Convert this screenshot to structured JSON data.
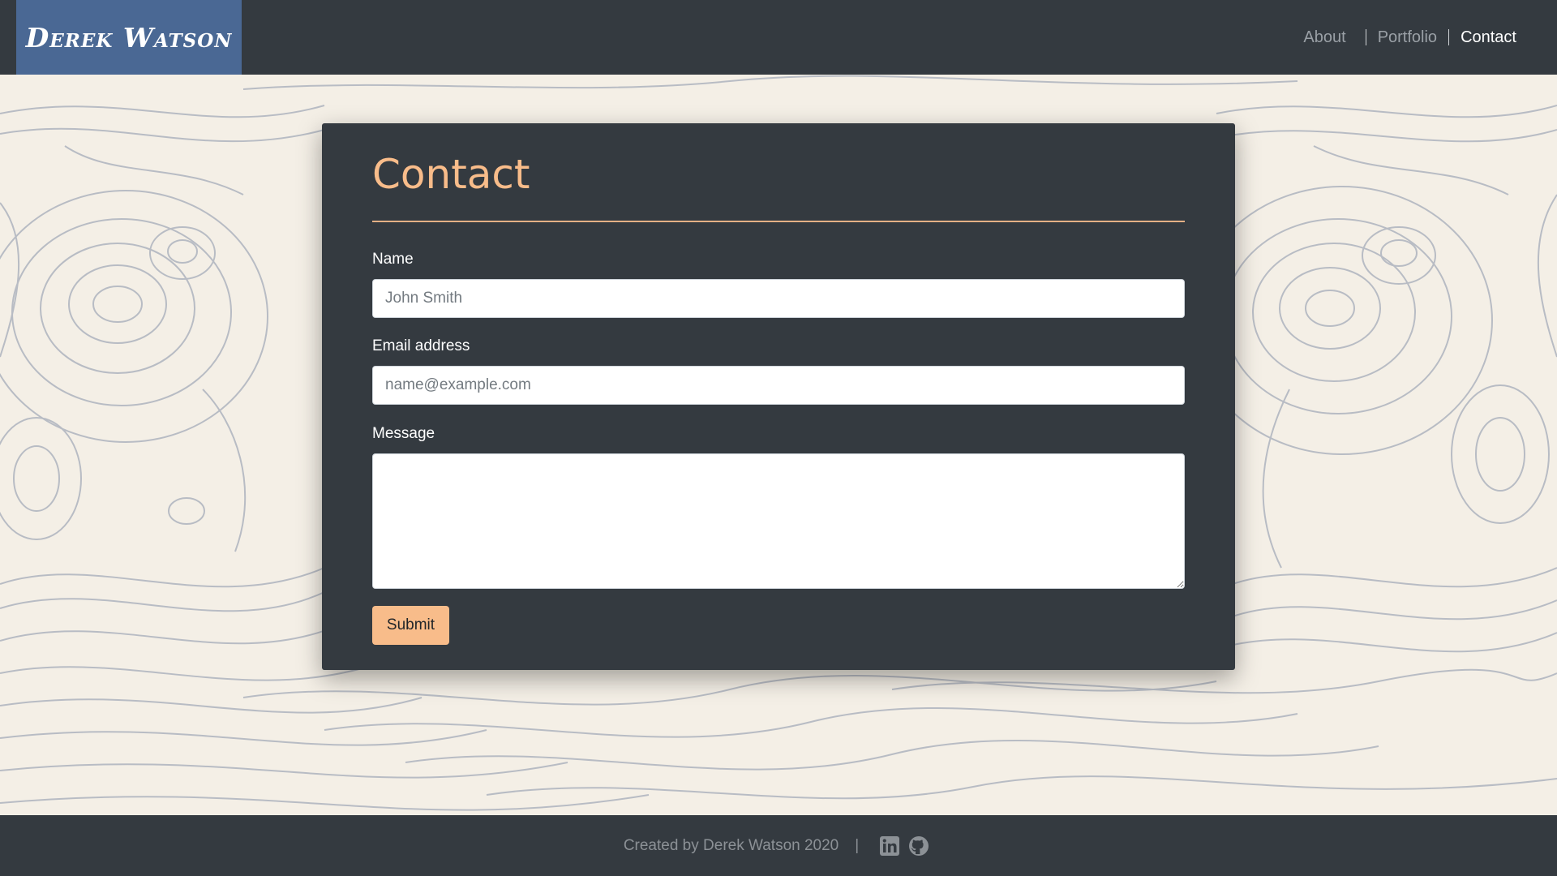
{
  "header": {
    "brand": "Derek Watson",
    "nav": [
      {
        "label": "About",
        "active": false
      },
      {
        "label": "Portfolio",
        "active": false
      },
      {
        "label": "Contact",
        "active": true
      }
    ]
  },
  "contact": {
    "title": "Contact",
    "fields": {
      "name": {
        "label": "Name",
        "placeholder": "John Smith",
        "value": ""
      },
      "email": {
        "label": "Email address",
        "placeholder": "name@example.com",
        "value": ""
      },
      "message": {
        "label": "Message",
        "value": ""
      }
    },
    "submit_label": "Submit"
  },
  "footer": {
    "credit": "Created by Derek Watson 2020",
    "separator": "|",
    "icons": [
      "linkedin-icon",
      "github-icon"
    ]
  },
  "colors": {
    "navbar": "#343a40",
    "brand_bg": "#4a6894",
    "accent": "#f8bc8a",
    "page_bg": "#f4efe6",
    "contour_lines": "#b8bcc4"
  }
}
